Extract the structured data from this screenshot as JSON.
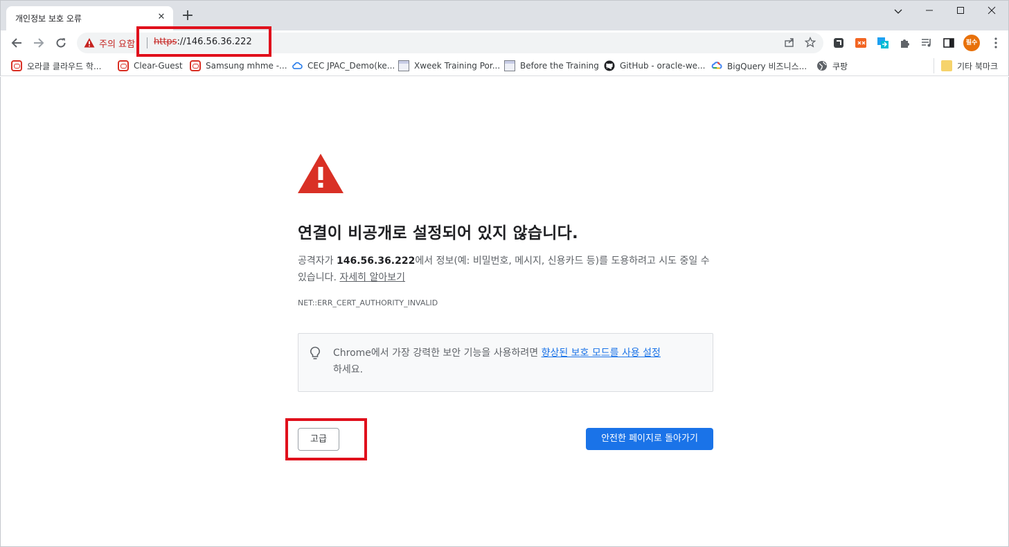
{
  "tab": {
    "title": "개인정보 보호 오류",
    "close": "✕",
    "new_tab": "+"
  },
  "window": {
    "minimize": "—",
    "maximize": "☐",
    "close": "✕",
    "tab_list": "⌄"
  },
  "omnibox": {
    "security_label": "주의 요함",
    "url_scheme": "https",
    "url_rest": "://146.56.36.222"
  },
  "profile": {
    "label": "필수"
  },
  "bookmarks": [
    {
      "label": "오라클 클라우드 학...",
      "icon": "oracle-icon"
    },
    {
      "label": "Clear-Guest",
      "icon": "oracle-icon"
    },
    {
      "label": "Samsung mhme -...",
      "icon": "oracle-icon"
    },
    {
      "label": "CEC JPAC_Demo(ke...",
      "icon": "cloud-icon"
    },
    {
      "label": "Xweek Training Por...",
      "icon": "page-icon"
    },
    {
      "label": "Before the Training",
      "icon": "page-icon"
    },
    {
      "label": "GitHub - oracle-we...",
      "icon": "github-icon"
    },
    {
      "label": "BigQuery 비즈니스...",
      "icon": "google-cloud-icon"
    },
    {
      "label": "쿠팡",
      "icon": "globe-icon"
    }
  ],
  "other_bookmarks": {
    "label": "기타 북마크",
    "icon": "folder-icon"
  },
  "interstitial": {
    "heading": "연결이 비공개로 설정되어 있지 않습니다.",
    "para_prefix": "공격자가 ",
    "host": "146.56.36.222",
    "para_suffix": "에서 정보(예: 비밀번호, 메시지, 신용카드 등)를 도용하려고 시도 중일 수 있습니다. ",
    "learn_more": "자세히 알아보기",
    "error_code": "NET::ERR_CERT_AUTHORITY_INVALID",
    "promo_prefix": "Chrome에서 가장 강력한 보안 기능을 사용하려면 ",
    "promo_link": "향상된 보호 모드를 사용 설정",
    "promo_suffix": "하세요.",
    "advanced_button": "고급",
    "back_button": "안전한 페이지로 돌아가기"
  },
  "colors": {
    "danger": "#d93025",
    "primary": "#1a73e8",
    "annotation": "#e0101c"
  }
}
